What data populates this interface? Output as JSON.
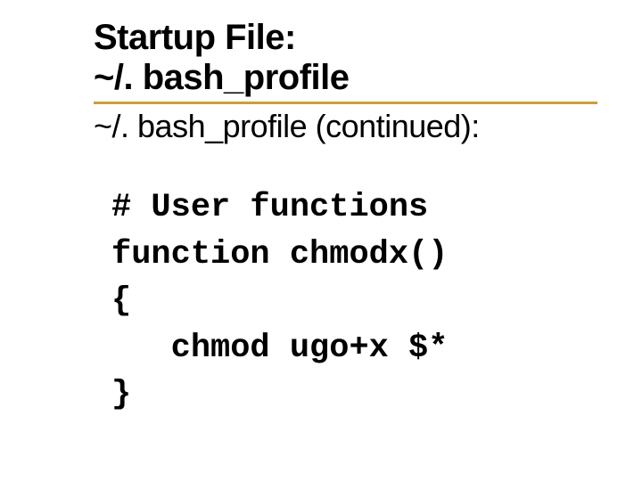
{
  "title_line1": "Startup File:",
  "title_line2": "~/. bash_profile",
  "subtitle": "~/. bash_profile (continued):",
  "code_line1": "# User functions",
  "code_line2": "function chmodx()",
  "code_line3": "{",
  "code_line4": "   chmod ugo+x $*",
  "code_line5": "}"
}
